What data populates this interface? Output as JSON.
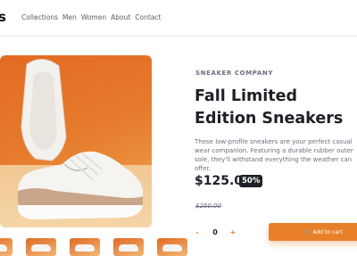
{
  "header": {
    "logo": "s",
    "nav": [
      "Collections",
      "Men",
      "Women",
      "About",
      "Contact"
    ]
  },
  "product": {
    "company": "SNEAKER COMPANY",
    "title": "Fall Limited Edition Sneakers",
    "description": "These low-profile sneakers are your perfect casual wear companion. Featuring a durable rubber outer sole, they'll withstand everything the weather can offer.",
    "price": "$125.00",
    "discount": "50%",
    "old_price": "$250.00"
  },
  "quantity": {
    "minus": "-",
    "value": "0",
    "plus": "+"
  },
  "cart": {
    "label": "Add to cart"
  },
  "colors": {
    "accent": "#e8802a",
    "dark": "#1d2026",
    "muted": "#68707d"
  }
}
